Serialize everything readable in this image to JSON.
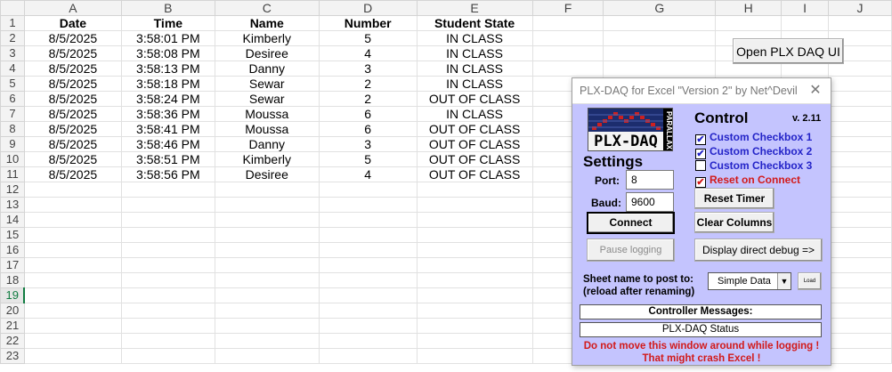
{
  "sheet": {
    "columns": [
      "A",
      "B",
      "C",
      "D",
      "E",
      "F",
      "G",
      "H",
      "I",
      "J"
    ],
    "row_numbers": [
      "1",
      "2",
      "3",
      "4",
      "5",
      "6",
      "7",
      "8",
      "9",
      "10",
      "11",
      "12",
      "13",
      "14",
      "15",
      "16",
      "17",
      "18",
      "19",
      "20",
      "21",
      "22",
      "23"
    ],
    "selected_row": "19",
    "headers": [
      "Date",
      "Time",
      "Name",
      "Number",
      "Student State"
    ],
    "rows": [
      [
        "8/5/2025",
        "3:58:01 PM",
        "Kimberly",
        "5",
        "IN CLASS"
      ],
      [
        "8/5/2025",
        "3:58:08 PM",
        "Desiree",
        "4",
        "IN CLASS"
      ],
      [
        "8/5/2025",
        "3:58:13 PM",
        "Danny",
        "3",
        "IN CLASS"
      ],
      [
        "8/5/2025",
        "3:58:18 PM",
        "Sewar",
        "2",
        "IN CLASS"
      ],
      [
        "8/5/2025",
        "3:58:24 PM",
        "Sewar",
        "2",
        "OUT OF CLASS"
      ],
      [
        "8/5/2025",
        "3:58:36 PM",
        "Moussa",
        "6",
        "IN CLASS"
      ],
      [
        "8/5/2025",
        "3:58:41 PM",
        "Moussa",
        "6",
        "OUT OF CLASS"
      ],
      [
        "8/5/2025",
        "3:58:46 PM",
        "Danny",
        "3",
        "OUT OF CLASS"
      ],
      [
        "8/5/2025",
        "3:58:51 PM",
        "Kimberly",
        "5",
        "OUT OF CLASS"
      ],
      [
        "8/5/2025",
        "3:58:56 PM",
        "Desiree",
        "4",
        "OUT OF CLASS"
      ]
    ]
  },
  "open_button_label": "Open PLX DAQ UI",
  "dialog": {
    "title": "PLX-DAQ for Excel \"Version 2\" by Net^Devil",
    "logo_text": "PLX-DAQ",
    "logo_brand": "PARALLAX",
    "control_heading": "Control",
    "version": "v. 2.11",
    "checkboxes": [
      {
        "label": "Custom Checkbox 1",
        "checked": true
      },
      {
        "label": "Custom Checkbox 2",
        "checked": true
      },
      {
        "label": "Custom Checkbox 3",
        "checked": false
      },
      {
        "label": "Reset on Connect",
        "checked": true
      }
    ],
    "settings_heading": "Settings",
    "port_label": "Port:",
    "port_value": "8",
    "baud_label": "Baud:",
    "baud_value": "9600",
    "reset_timer_label": "Reset Timer",
    "connect_label": "Connect",
    "clear_columns_label": "Clear Columns",
    "pause_logging_label": "Pause logging",
    "display_debug_label": "Display direct debug =>",
    "sheet_name_label_1": "Sheet name to post to:",
    "sheet_name_label_2": "(reload after renaming)",
    "sheet_select_value": "Simple Data",
    "load_label": "Load",
    "controller_messages_label": "Controller Messages:",
    "status_text": "PLX-DAQ Status",
    "warning_1": "Do not move this window around while logging !",
    "warning_2": "That might crash Excel !"
  },
  "colors": {
    "dialog_bg": "#c4c4fe",
    "checkbox_blue": "#2424c8",
    "warning_red": "#d21a1a",
    "selected_row_green": "#107c41"
  }
}
